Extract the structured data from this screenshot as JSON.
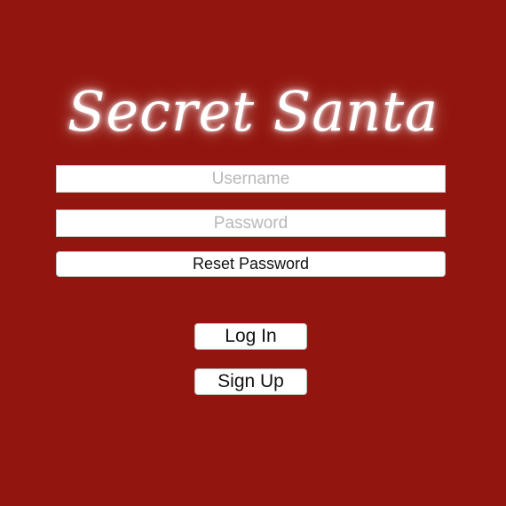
{
  "app": {
    "title": "Secret Santa"
  },
  "login_form": {
    "username_placeholder": "Username",
    "username_value": "",
    "password_placeholder": "Password",
    "password_value": "",
    "reset_password_label": "Reset Password"
  },
  "actions": {
    "login_label": "Log In",
    "signup_label": "Sign Up"
  },
  "colors": {
    "background": "#92160f",
    "title_text": "#ffffff",
    "field_background": "#ffffff",
    "placeholder_text": "#b8b8b8"
  }
}
